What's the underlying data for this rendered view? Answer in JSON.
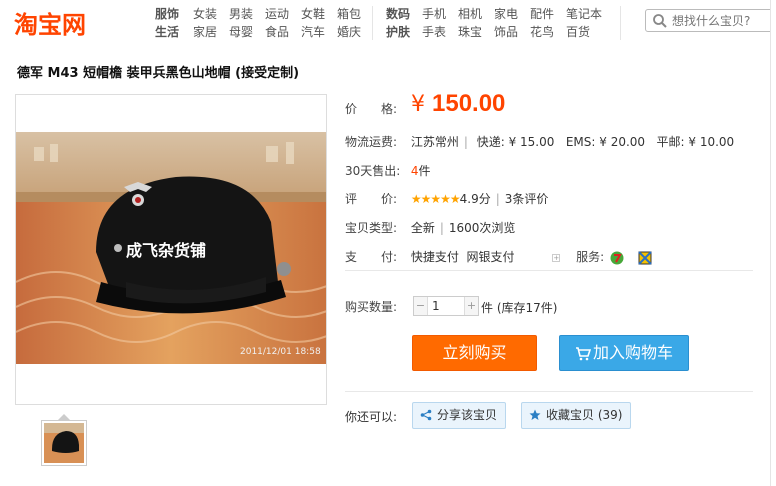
{
  "header": {
    "logo": "淘宝网",
    "nav_groups": [
      {
        "head1": "服饰",
        "head2": "生活",
        "items1": [
          "女装",
          "男装",
          "运动",
          "女鞋",
          "箱包"
        ],
        "items2": [
          "家居",
          "母婴",
          "食品",
          "汽车",
          "婚庆"
        ]
      },
      {
        "head1": "数码",
        "head2": "护肤",
        "items1": [
          "手机",
          "相机",
          "家电",
          "配件",
          "笔记本"
        ],
        "items2": [
          "手表",
          "珠宝",
          "饰品",
          "花鸟",
          "百货"
        ]
      }
    ],
    "search": {
      "placeholder": "想找什么宝贝?"
    }
  },
  "product": {
    "title": "德军 M43 短帽檐 装甲兵黑色山地帽 (接受定制)",
    "image_watermark": "成飞杂货铺",
    "image_timestamp": "2011/12/01 18:58",
    "price_label": "价　　格:",
    "price_symbol": "¥",
    "price": "150.00",
    "shipping_label": "物流运费:",
    "shipping_from": "江苏常州",
    "shipping_express": "快递: ¥ 15.00",
    "shipping_ems": "EMS: ¥ 20.00",
    "shipping_post": "平邮: ¥ 10.00",
    "sold_label": "30天售出:",
    "sold_count": "4",
    "sold_unit": "件",
    "rating_label": "评　　价:",
    "rating_stars": "★★★★★",
    "rating_score": "4.9分",
    "rating_count": "3条评价",
    "type_label": "宝贝类型:",
    "type_value": "全新",
    "views": "1600次浏览",
    "pay_label": "支　　付:",
    "pay_quick": "快捷支付",
    "pay_bank": "网银支付",
    "service_label": "服务:",
    "qty_label": "购买数量:",
    "qty_value": "1",
    "qty_unit": "件 (库存17件)",
    "buy_now": "立刻购买",
    "add_to_cart": "加入购物车",
    "also_label": "你还可以:",
    "share": "分享该宝贝",
    "favorite": "收藏宝贝 (39)"
  },
  "colors": {
    "accent": "#ff4400",
    "buy": "#ff6a00",
    "cart": "#3aa8e7",
    "star": "#ffa300"
  }
}
